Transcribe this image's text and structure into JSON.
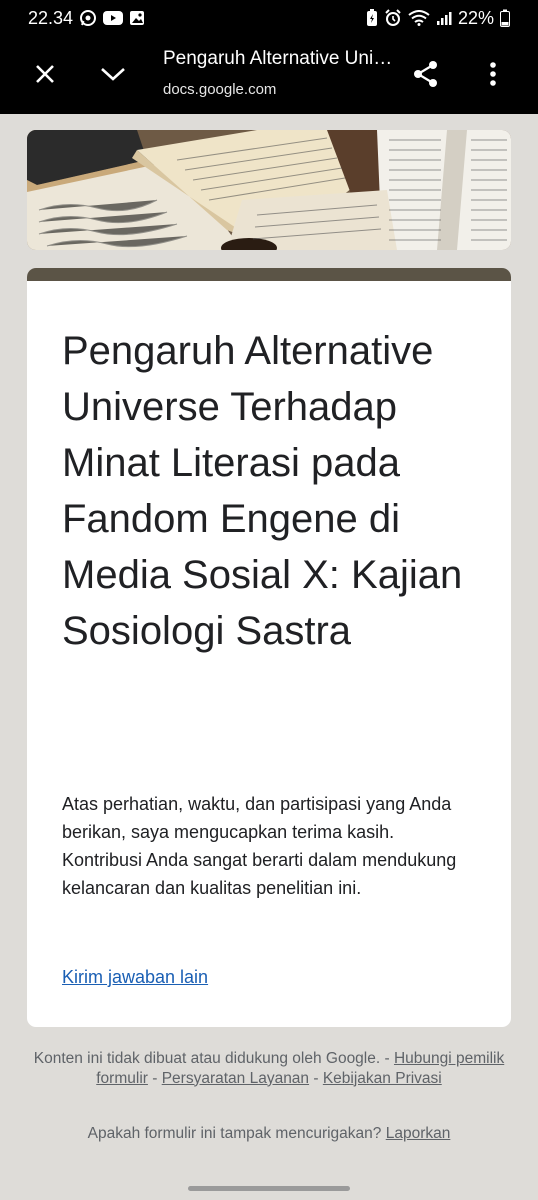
{
  "status_bar": {
    "time": "22.34",
    "battery": "22%",
    "left_icons": [
      "whatsapp-icon",
      "youtube-icon",
      "gallery-icon"
    ],
    "right_icons": [
      "battery-saver-icon",
      "alarm-icon",
      "wifi-icon",
      "signal-icon",
      "battery-icon"
    ]
  },
  "browser": {
    "title": "Pengaruh Alternative Universe Terhadap Minat Literasi pada Fandom Engene di Media Sosial X: Kajian Sosiologi Sastra",
    "url": "docs.google.com",
    "close_icon": "close-icon",
    "expand_icon": "chevron-down-icon",
    "share_icon": "share-icon",
    "menu_icon": "more-vert-icon"
  },
  "form": {
    "title": "Pengaruh Alternative Universe Terhadap Minat Literasi pada Fandom Engene di Media Sosial X: Kajian Sosiologi Sastra",
    "confirmation": "Atas perhatian, waktu, dan partisipasi yang Anda berikan, saya mengucapkan terima kasih. Kontribusi Anda sangat berarti dalam mendukung kelancaran dan kualitas penelitian ini.",
    "submit_another": "Kirim jawaban lain",
    "accent_color": "#5b5446"
  },
  "footer": {
    "disclaimer": "Konten ini tidak dibuat atau didukung oleh Google.",
    "sep": " - ",
    "contact_owner": "Hubungi pemilik formulir",
    "terms": "Persyaratan Layanan",
    "privacy": "Kebijakan Privasi",
    "suspicious_question": "Apakah formulir ini tampak mencurigakan?",
    "report": "Laporkan"
  }
}
